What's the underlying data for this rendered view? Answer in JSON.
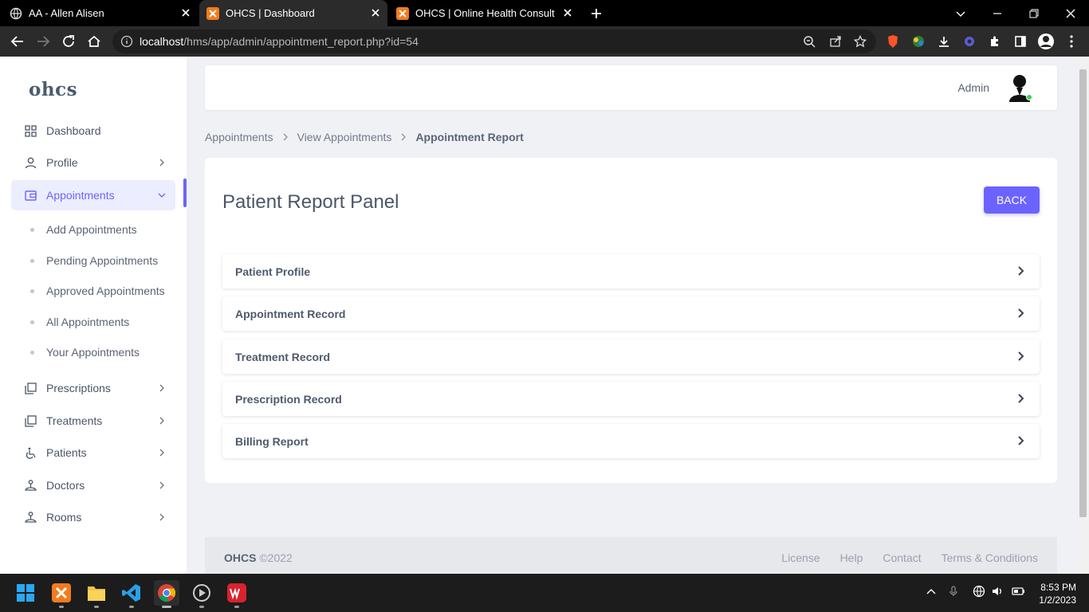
{
  "browser": {
    "tabs": [
      {
        "title": "AA - Allen Alisen",
        "icon": "globe-icon"
      },
      {
        "title": "OHCS | Dashboard",
        "icon": "xampp-icon"
      },
      {
        "title": "OHCS | Online Health Consultatio",
        "icon": "xampp-icon"
      }
    ],
    "url_host": "localhost",
    "url_path": "/hms/app/admin/appointment_report.php?id=54"
  },
  "app": {
    "logo": "ohcs",
    "sidebar": [
      {
        "label": "Dashboard",
        "icon": "grid-icon"
      },
      {
        "label": "Profile",
        "icon": "user-icon"
      },
      {
        "label": "Appointments",
        "icon": "wallet-icon"
      },
      {
        "label": "Prescriptions",
        "icon": "copy-icon"
      },
      {
        "label": "Treatments",
        "icon": "copy-icon"
      },
      {
        "label": "Patients",
        "icon": "wheelchair-icon"
      },
      {
        "label": "Doctors",
        "icon": "doctor-icon"
      },
      {
        "label": "Rooms",
        "icon": "doctor-icon"
      }
    ],
    "submenu": [
      "Add Appointments",
      "Pending Appointments",
      "Approved Appointments",
      "All Appointments",
      "Your Appointments"
    ],
    "user": "Admin",
    "breadcrumbs": [
      "Appointments",
      "View Appointments",
      "Appointment Report"
    ],
    "panel_title": "Patient Report Panel",
    "back_label": "BACK",
    "sections": [
      "Patient Profile",
      "Appointment Record",
      "Treatment Record",
      "Prescription Record",
      "Billing Report"
    ],
    "footer": {
      "brand": "OHCS",
      "year": "©2022",
      "links": [
        "License",
        "Help",
        "Contact",
        "Terms & Conditions"
      ]
    }
  },
  "taskbar": {
    "time": "8:53 PM",
    "date": "1/2/2023"
  },
  "colors": {
    "accent": "#6c63ff",
    "online": "#3ecf5a"
  }
}
